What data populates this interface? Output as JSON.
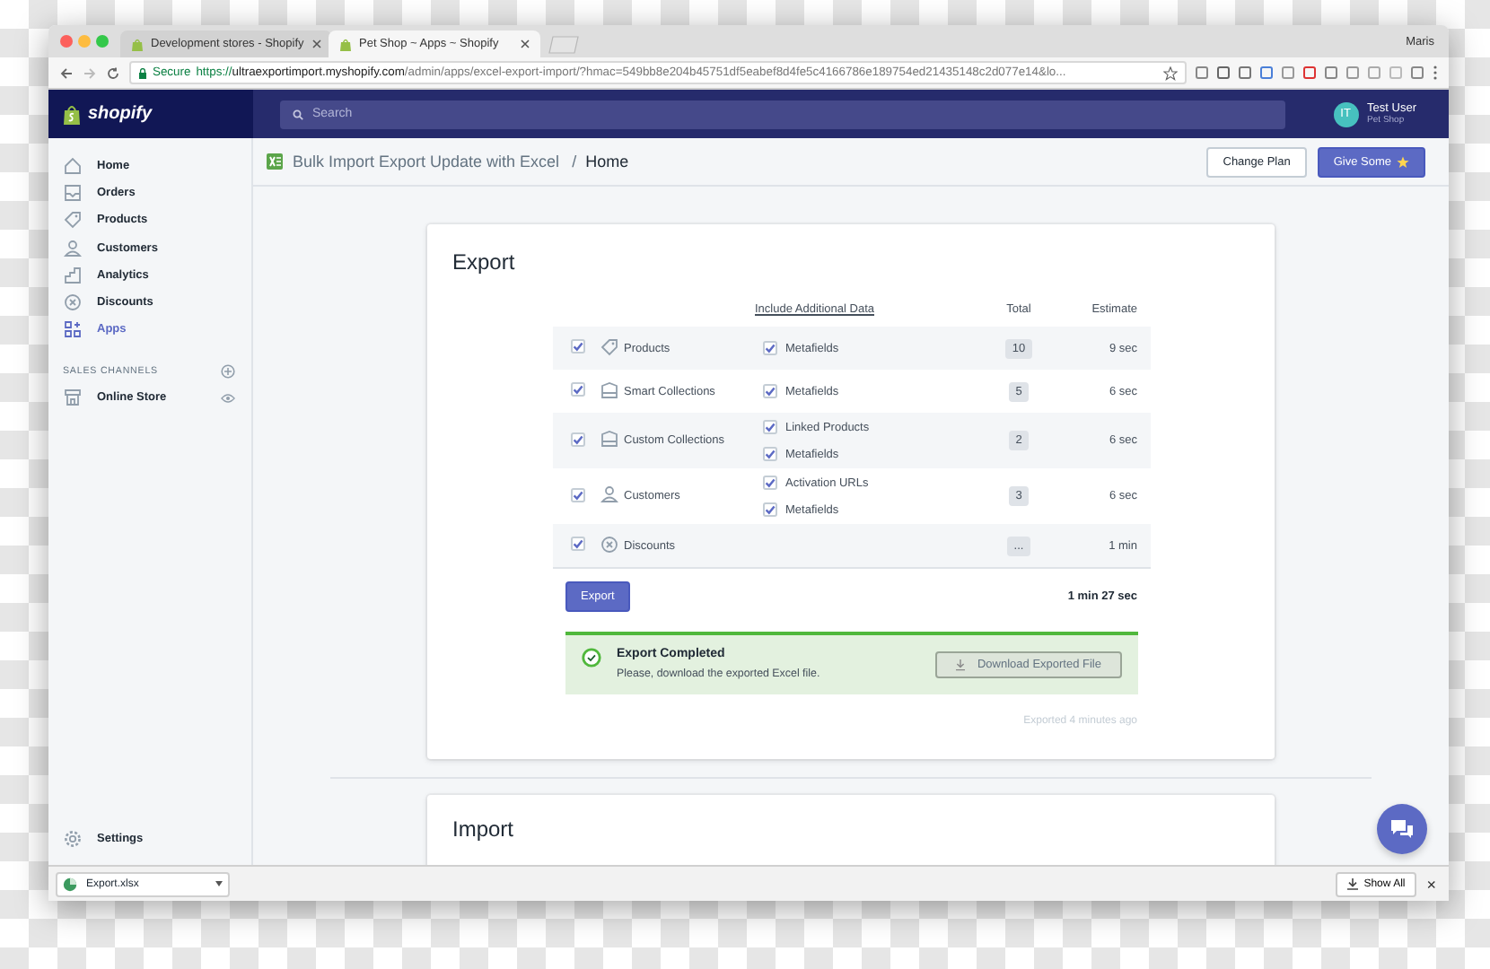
{
  "browser": {
    "tabs": [
      {
        "title": "Development stores - Shopify",
        "selected": false
      },
      {
        "title": "Pet Shop ~ Apps ~ Shopify",
        "selected": true
      }
    ],
    "user": "Maris",
    "address": {
      "secure_label": "Secure",
      "scheme": "https://",
      "host": "ultraexportimport.myshopify.com",
      "path": "/admin/apps/excel-export-import/?hmac=549bb8e204b45751df5eabef8d4fe5c4166786e189754ed21435148c2d077e14&lo..."
    }
  },
  "topbar": {
    "logo": "shopify",
    "search_placeholder": "Search",
    "user": {
      "initials": "IT",
      "name": "Test User",
      "store": "Pet Shop"
    }
  },
  "sidebar": {
    "items": [
      {
        "label": "Home",
        "kind": "home",
        "selected": false
      },
      {
        "label": "Orders",
        "kind": "orders",
        "selected": false
      },
      {
        "label": "Products",
        "kind": "products",
        "selected": false
      },
      {
        "label": "Customers",
        "kind": "customers",
        "selected": false
      },
      {
        "label": "Analytics",
        "kind": "analytics",
        "selected": false
      },
      {
        "label": "Discounts",
        "kind": "discounts",
        "selected": false
      },
      {
        "label": "Apps",
        "kind": "apps",
        "selected": true
      }
    ],
    "section_title": "SALES CHANNELS",
    "channels": [
      {
        "label": "Online Store",
        "selected": false
      }
    ],
    "footer": {
      "label": "Settings"
    }
  },
  "header": {
    "app_name": "Bulk Import Export Update with Excel",
    "separator": "/",
    "page": "Home",
    "buttons": [
      {
        "label": "Change Plan",
        "kind": "secondary"
      },
      {
        "label": "Give Some",
        "kind": "primary"
      }
    ]
  },
  "export": {
    "title": "Export",
    "columns": [
      "Include Additional Data",
      "Total",
      "Estimate"
    ],
    "rows": [
      {
        "name": "Products",
        "kind": "tag",
        "checked": true,
        "options": [
          {
            "label": "Metafields",
            "checked": true
          }
        ],
        "total": "10",
        "estimate": "9 sec"
      },
      {
        "name": "Smart Collections",
        "kind": "collection",
        "checked": true,
        "options": [
          {
            "label": "Metafields",
            "checked": true
          }
        ],
        "total": "5",
        "estimate": "6 sec"
      },
      {
        "name": "Custom Collections",
        "kind": "collection",
        "checked": true,
        "options": [
          {
            "label": "Linked Products",
            "checked": true
          },
          {
            "label": "Metafields",
            "checked": true
          }
        ],
        "total": "2",
        "estimate": "6 sec"
      },
      {
        "name": "Customers",
        "kind": "person",
        "checked": true,
        "options": [
          {
            "label": "Activation URLs",
            "checked": true
          },
          {
            "label": "Metafields",
            "checked": true
          }
        ],
        "total": "3",
        "estimate": "6 sec"
      },
      {
        "name": "Discounts",
        "kind": "discount",
        "checked": true,
        "options": [],
        "total": "...",
        "estimate": "1 min"
      }
    ],
    "button": "Export",
    "total_time": "1 min 27 sec",
    "notice": {
      "title": "Export Completed",
      "message": "Please, download the exported Excel file.",
      "button": "Download Exported File"
    },
    "footnote": "Exported 4 minutes ago"
  },
  "import": {
    "title": "Import"
  },
  "downloads": {
    "file": "Export.xlsx",
    "show_all": "Show All",
    "close": "×"
  }
}
